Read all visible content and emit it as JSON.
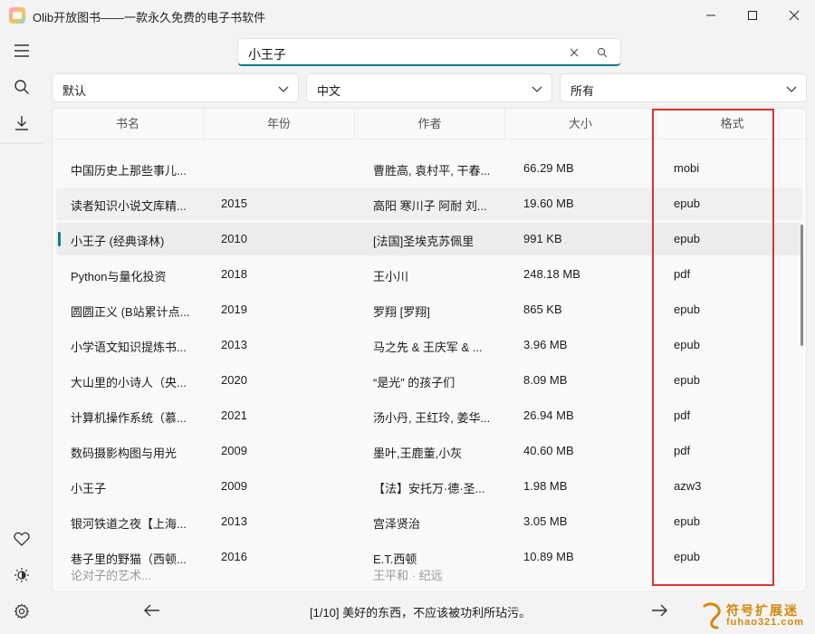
{
  "window": {
    "title": "Olib开放图书——一款永久免费的电子书软件"
  },
  "sidebar": {
    "top": [
      "menu-icon",
      "search-icon",
      "download-icon"
    ],
    "bottom": [
      "heart-icon",
      "theme-icon",
      "settings-icon"
    ]
  },
  "search": {
    "value": "小王子"
  },
  "filters": {
    "sort": "默认",
    "language": "中文",
    "format": "所有"
  },
  "table": {
    "columns": [
      "书名",
      "年份",
      "作者",
      "大小",
      "格式"
    ],
    "rows": [
      {
        "name": "中国历史上那些事儿...",
        "year": "",
        "author": "曹胜高, 袁村平, 干春...",
        "size": "66.29 MB",
        "format": "mobi"
      },
      {
        "name": "读者知识小说文库精...",
        "year": "2015",
        "author": "高阳 寒川子 阿耐 刘...",
        "size": "19.60 MB",
        "format": "epub"
      },
      {
        "name": "小王子 (经典译林)",
        "year": "2010",
        "author": "[法国]圣埃克苏佩里",
        "size": "991 KB",
        "format": "epub"
      },
      {
        "name": "Python与量化投资",
        "year": "2018",
        "author": "王小川",
        "size": "248.18 MB",
        "format": "pdf"
      },
      {
        "name": "圆圆正义 (B站累计点...",
        "year": "2019",
        "author": "罗翔 [罗翔]",
        "size": "865 KB",
        "format": "epub"
      },
      {
        "name": "小学语文知识提炼书...",
        "year": "2013",
        "author": "马之先 & 王庆军 & ...",
        "size": "3.96 MB",
        "format": "epub"
      },
      {
        "name": "大山里的小诗人（央...",
        "year": "2020",
        "author": "“是光” 的孩子们",
        "size": "8.09 MB",
        "format": "epub"
      },
      {
        "name": "计算机操作系统（慕...",
        "year": "2021",
        "author": "汤小丹, 王红玲, 姜华...",
        "size": "26.94 MB",
        "format": "pdf"
      },
      {
        "name": "数码摄影构图与用光",
        "year": "2009",
        "author": "墨叶,王鹿董,小灰",
        "size": "40.60 MB",
        "format": "pdf"
      },
      {
        "name": "小王子",
        "year": "2009",
        "author": "【法】安托万·德·圣...",
        "size": "1.98 MB",
        "format": "azw3"
      },
      {
        "name": "银河铁道之夜【上海...",
        "year": "2013",
        "author": "宫泽贤治",
        "size": "3.05 MB",
        "format": "epub"
      },
      {
        "name": "巷子里的野猫（西顿...",
        "year": "2016",
        "author": "E.T.西顿",
        "size": "10.89 MB",
        "format": "epub"
      }
    ],
    "partial_row": {
      "name": "论对子的艺术...",
      "author": "王平和 · 纪远"
    }
  },
  "footer": {
    "quote": "[1/10] 美好的东西，不应该被功利所玷污。"
  },
  "watermark": {
    "main": "符号扩展迷",
    "sub": "fuhao321.com"
  },
  "colors": {
    "accent": "#0f7b8a",
    "highlight": "#e03131"
  }
}
